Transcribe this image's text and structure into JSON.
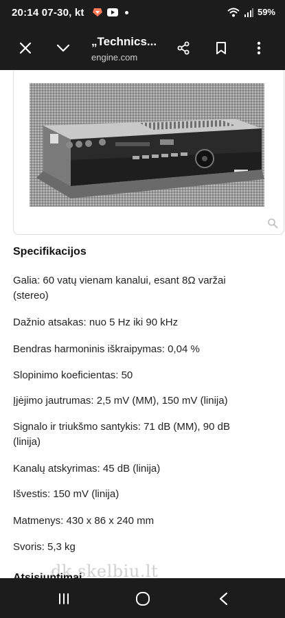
{
  "status": {
    "time": "20:14",
    "date": "07-30, kt",
    "battery": "59%",
    "icons": [
      "gallery-app-icon",
      "youtube-icon",
      "wifi-icon",
      "signal-icon",
      "battery-icon"
    ]
  },
  "toolbar": {
    "title": "„Technics...",
    "url": "engine.com",
    "buttons": [
      "close-icon",
      "chevron-down-icon",
      "share-icon",
      "bookmark-icon",
      "more-vert-icon"
    ]
  },
  "article": {
    "section_title": "Specifikacijos",
    "specs": [
      "Galia: 60 vatų vienam kanalui, esant 8Ω varžai (stereo)",
      "Dažnio atsakas: nuo 5 Hz iki 90 kHz",
      "Bendras harmoninis iškraipymas: 0,04 %",
      "Slopinimo koeficientas: 50",
      "Įjėjimo jautrumas: 2,5 mV (MM), 150 mV (linija)",
      "Signalo ir triukšmo santykis: 71 dB (MM), 90 dB (linija)",
      "Kanalų atskyrimas: 45 dB (linija)",
      "Išvestis: 150 mV (linija)",
      "Matmenys: 430 x 86 x 240 mm",
      "Svoris: 5,3 kg"
    ],
    "next_section": "Atsisiuntimai",
    "watermark": "dk.skelbiu.lt"
  },
  "navbar": [
    "recents-icon",
    "home-icon",
    "back-icon"
  ],
  "colors": {
    "bar_bg": "#1c1c1c",
    "page_bg": "#ffffff",
    "text": "#222222"
  }
}
